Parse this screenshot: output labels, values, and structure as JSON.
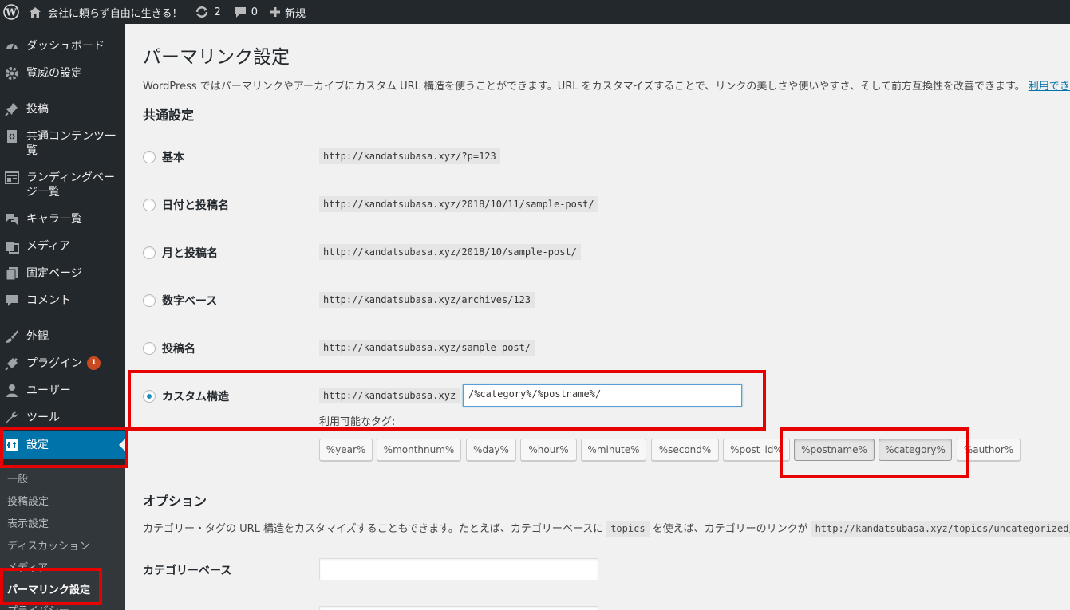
{
  "adminbar": {
    "site_name": "会社に頼らず自由に生きる！",
    "updates_count": "2",
    "comments_count": "0",
    "new_label": "新規"
  },
  "sidebar": {
    "items": [
      {
        "label": "ダッシュボード",
        "icon": "dashboard-icon"
      },
      {
        "label": "覧威の設定",
        "icon": "gear-icon"
      },
      {
        "label": "投稿",
        "icon": "pin-icon"
      },
      {
        "label": "共通コンテンツ一覧",
        "icon": "code-file-icon"
      },
      {
        "label": "ランディングページ一覧",
        "icon": "layout-icon"
      },
      {
        "label": "キャラ一覧",
        "icon": "chat-icon"
      },
      {
        "label": "メディア",
        "icon": "media-icon"
      },
      {
        "label": "固定ページ",
        "icon": "pages-icon"
      },
      {
        "label": "コメント",
        "icon": "comment-icon"
      },
      {
        "label": "外観",
        "icon": "brush-icon"
      },
      {
        "label": "プラグイン",
        "icon": "plugin-icon",
        "badge": "1"
      },
      {
        "label": "ユーザー",
        "icon": "user-icon"
      },
      {
        "label": "ツール",
        "icon": "wrench-icon"
      },
      {
        "label": "設定",
        "icon": "settings-icon"
      }
    ],
    "submenu": [
      "一般",
      "投稿設定",
      "表示設定",
      "ディスカッション",
      "メディア",
      "パーマリンク設定",
      "プライバシー"
    ]
  },
  "main": {
    "title": "パーマリンク設定",
    "intro": "WordPress ではパーマリンクやアーカイブにカスタム URL 構造を使うことができます。URL をカスタマイズすることで、リンクの美しさや使いやすさ、そして前方互換性を改善できます。",
    "intro_link": "利用できる",
    "common_heading": "共通設定",
    "options": [
      {
        "label": "基本",
        "sample": "http://kandatsubasa.xyz/?p=123"
      },
      {
        "label": "日付と投稿名",
        "sample": "http://kandatsubasa.xyz/2018/10/11/sample-post/"
      },
      {
        "label": "月と投稿名",
        "sample": "http://kandatsubasa.xyz/2018/10/sample-post/"
      },
      {
        "label": "数字ベース",
        "sample": "http://kandatsubasa.xyz/archives/123"
      },
      {
        "label": "投稿名",
        "sample": "http://kandatsubasa.xyz/sample-post/"
      },
      {
        "label": "カスタム構造",
        "sample": "http://kandatsubasa.xyz"
      }
    ],
    "custom_value": "/%category%/%postname%/",
    "available_tags_label": "利用可能なタグ:",
    "tags": [
      "%year%",
      "%monthnum%",
      "%day%",
      "%hour%",
      "%minute%",
      "%second%",
      "%post_id%",
      "%postname%",
      "%category%",
      "%author%"
    ],
    "options_heading": "オプション",
    "options_desc_1": "カテゴリー・タグの URL 構造をカスタマイズすることもできます。たとえば、カテゴリーベースに",
    "options_desc_code": "topics",
    "options_desc_2": "を使えば、カテゴリーのリンクが",
    "options_desc_code2": "http://kandatsubasa.xyz/topics/uncategorized/",
    "category_base_label": "カテゴリーベース",
    "category_base_value": ""
  },
  "colors": {
    "adminbar_bg": "#23282d",
    "sidebar_bg": "#23282d",
    "accent": "#0073aa",
    "highlight_red": "#e60000",
    "link": "#0073aa"
  }
}
